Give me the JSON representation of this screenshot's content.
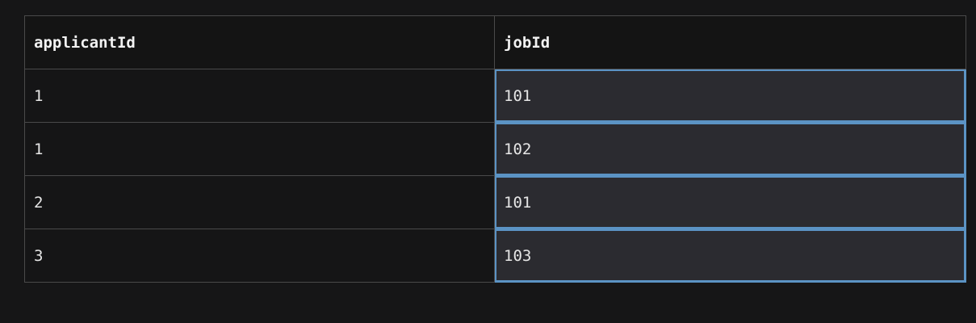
{
  "table": {
    "columns": [
      "applicantId",
      "jobId"
    ],
    "rows": [
      [
        "1",
        "101"
      ],
      [
        "1",
        "102"
      ],
      [
        "2",
        "101"
      ],
      [
        "3",
        "103"
      ]
    ],
    "selected_column": "jobId"
  },
  "colors": {
    "background": "#161617",
    "cell_background": "#151516",
    "selected_cell_background": "#2b2b30",
    "selection_border": "#5b93c4",
    "grid_line": "#4a4a4a",
    "text": "#e6e6e6"
  }
}
